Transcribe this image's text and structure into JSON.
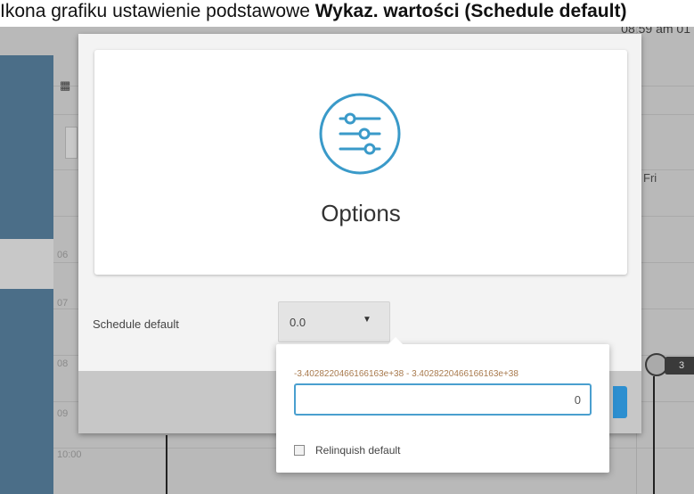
{
  "caption": {
    "lead": "Ikona grafiku ustawienie podstawowe",
    "bold": "Wykaz. wartości",
    "tail": "(Schedule default)"
  },
  "background": {
    "time": "08:59 am   01",
    "day_fri": "Fri",
    "row_labels": [
      "06",
      "07",
      "08",
      "09",
      "10:00"
    ],
    "toggle_value": "3"
  },
  "modal": {
    "title": "Options",
    "icon": "sliders-icon",
    "schedule_default_label": "Schedule default",
    "schedule_default_value": "0.0",
    "caret": "▼"
  },
  "popover": {
    "range": "-3.4028220466166163e+38 - 3.4028220466166163e+38",
    "input_value": "0",
    "relinquish_label": "Relinquish default"
  },
  "colors": {
    "accent": "#2d8fd0",
    "icon_ring": "#3a9ac9",
    "sidebar": "#4b6e88",
    "range_text": "#a87a4d"
  }
}
